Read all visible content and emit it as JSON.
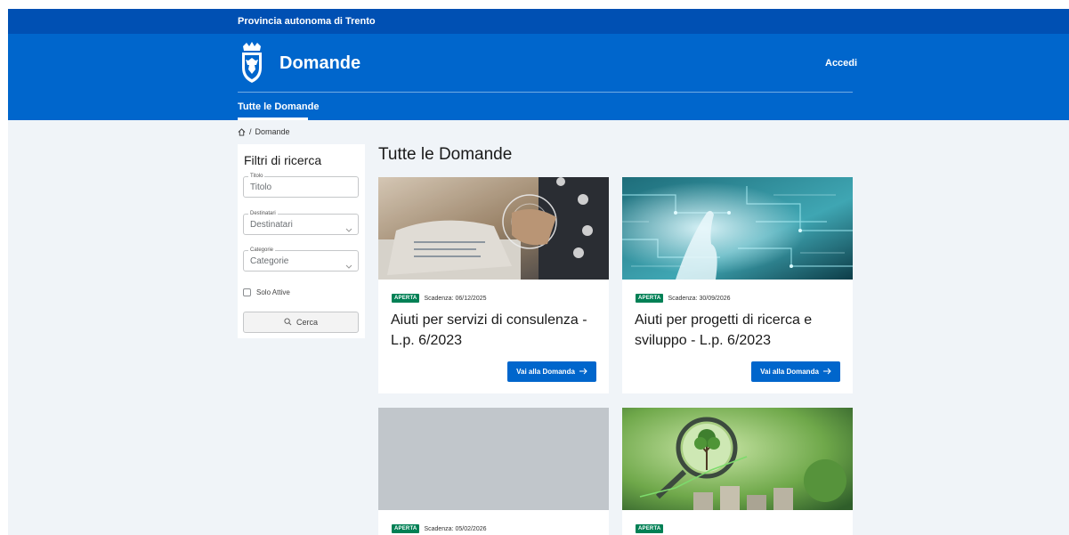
{
  "slim_header": {
    "title": "Provincia autonoma di Trento"
  },
  "header": {
    "app_title": "Domande",
    "login_label": "Accedi",
    "logo_icon": "coat-of-arms-icon"
  },
  "nav": {
    "tabs": [
      {
        "label": "Tutte le Domande",
        "active": true
      }
    ]
  },
  "breadcrumb": {
    "home_icon": "home-icon",
    "separator": "/",
    "current": "Domande"
  },
  "filters": {
    "title": "Filtri di ricerca",
    "titolo": {
      "legend": "Titolo",
      "placeholder": "Titolo"
    },
    "destinatari": {
      "legend": "Destinatari",
      "value": "Destinatari"
    },
    "categorie": {
      "legend": "Categorie",
      "value": "Categorie"
    },
    "solo_attive": {
      "label": "Solo Attive",
      "checked": false
    },
    "search_button": "Cerca"
  },
  "results": {
    "title": "Tutte le Domande",
    "cards": [
      {
        "badge": "APERTA",
        "deadline": "Scadenza: 06/12/2025",
        "title": "Aiuti per servizi di consulenza - L.p. 6/2023",
        "button": "Vai alla Domanda",
        "image": "consulting-photo"
      },
      {
        "badge": "APERTA",
        "deadline": "Scadenza: 30/09/2026",
        "title": "Aiuti per progetti di ricerca e sviluppo - L.p. 6/2023",
        "button": "Vai alla Domanda",
        "image": "circuit-board-photo"
      },
      {
        "badge": "APERTA",
        "deadline": "Scadenza: 05/02/2026",
        "image": "placeholder-gray"
      },
      {
        "badge": "APERTA",
        "deadline": "",
        "image": "green-magnifier-photo"
      }
    ]
  },
  "colors": {
    "slim_header": "#0050b3",
    "header": "#0066cc",
    "badge": "#008055",
    "page_bg": "#f0f4f8"
  }
}
